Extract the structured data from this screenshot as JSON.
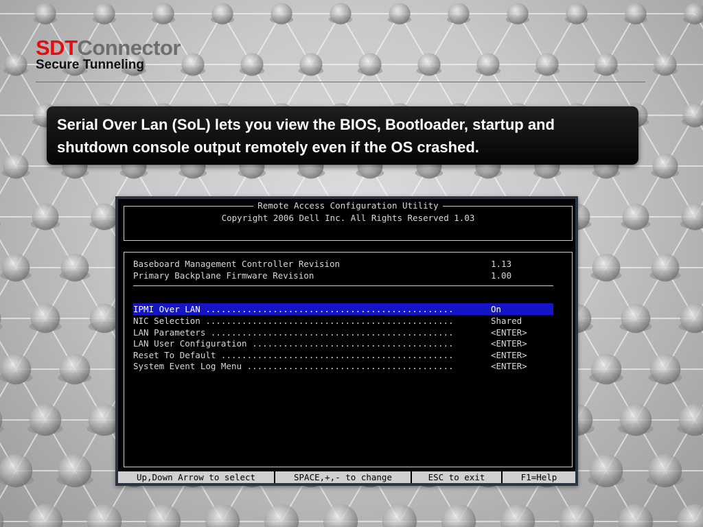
{
  "brand": {
    "name_red": "SDT",
    "name_gray": "Connector",
    "subtitle": "Secure Tunneling"
  },
  "callout": {
    "text": "Serial Over Lan (SoL) lets you view the BIOS, Bootloader, startup and shutdown console output remotely even if the OS crashed."
  },
  "bios": {
    "title": "Remote Access Configuration Utility",
    "copyright": "Copyright 2006 Dell Inc. All Rights Reserved 1.03",
    "info": [
      {
        "label": "Baseboard Management Controller Revision",
        "value": "1.13"
      },
      {
        "label": "Primary Backplane Firmware Revision",
        "value": "1.00"
      }
    ],
    "menu": [
      {
        "label": "IPMI Over LAN ................................................",
        "value": "On"
      },
      {
        "label": "NIC Selection ................................................",
        "value": "Shared"
      },
      {
        "label": "LAN Parameters ...............................................",
        "value": "<ENTER>"
      },
      {
        "label": "LAN User Configuration .......................................",
        "value": "<ENTER>"
      },
      {
        "label": "Reset To Default .............................................",
        "value": "<ENTER>"
      },
      {
        "label": "System Event Log Menu ........................................",
        "value": "<ENTER>"
      }
    ],
    "status": [
      "Up,Down Arrow to select",
      "SPACE,+,- to change",
      "ESC to exit",
      "F1=Help"
    ]
  },
  "colors": {
    "accent_red": "#e01010",
    "selection_blue": "#1515c8",
    "screen_bg": "#000000"
  }
}
